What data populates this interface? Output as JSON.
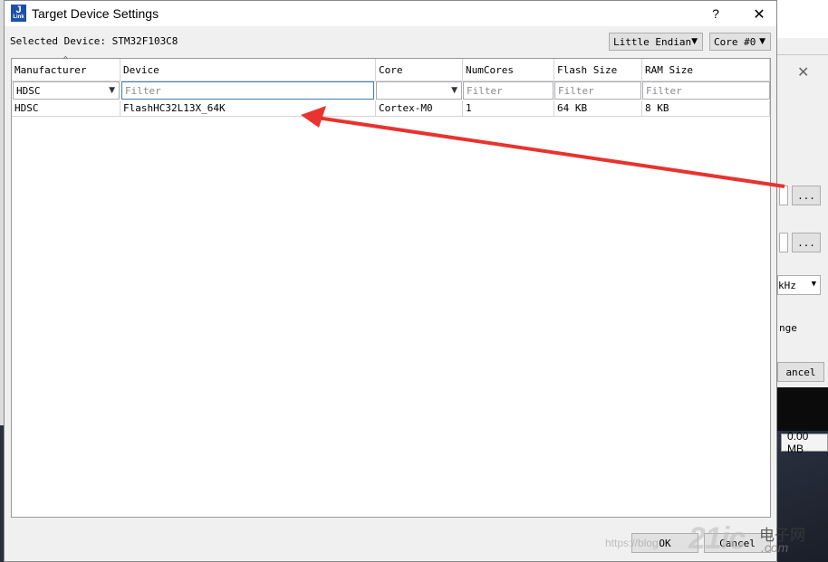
{
  "window": {
    "title": "Target Device Settings",
    "icon_label": "J",
    "icon_sublabel": "Link",
    "help": "?",
    "close": "✕"
  },
  "selected_device": {
    "label": "Selected Device: STM32F103C8"
  },
  "endian_combo": {
    "value": "Little Endian"
  },
  "core_combo": {
    "value": "Core #0"
  },
  "table": {
    "headers": [
      "Manufacturer",
      "Device",
      "Core",
      "NumCores",
      "Flash Size",
      "RAM Size"
    ],
    "filters": {
      "manufacturer": "HDSC",
      "device": "Filter",
      "core": "",
      "numcores": "Filter",
      "flash": "Filter",
      "ram": "Filter"
    },
    "rows": [
      [
        "HDSC",
        "FlashHC32L13X_64K",
        "Cortex-M0",
        "1",
        "64 KB",
        "8 KB"
      ]
    ]
  },
  "buttons": {
    "ok": "OK",
    "cancel": "Cancel"
  },
  "background_app": {
    "browse_btn_1": "...",
    "browse_btn_2": "...",
    "speed_value": "kHz",
    "range_text": "nge",
    "cancel_text": "ancel",
    "size_value": "0.00 MB"
  },
  "watermark": {
    "url": "https://blog.",
    "logo": "21ic",
    "cn": "电子网",
    "com": ".com"
  },
  "colors": {
    "accent_arrow": "#e8332e",
    "selection_border": "#3c7fb1",
    "app_icon": "#1e4fa8"
  }
}
